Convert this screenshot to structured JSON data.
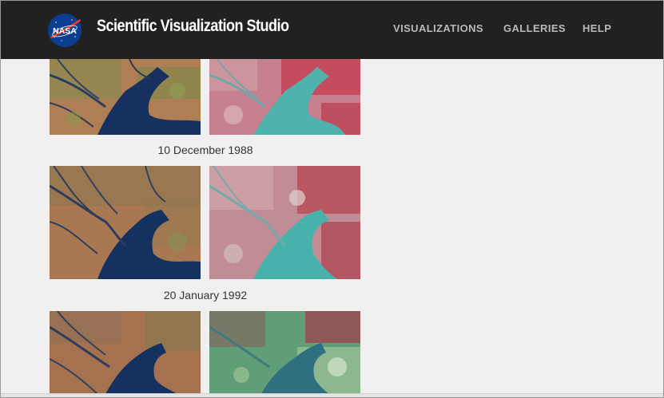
{
  "header": {
    "logo_text": "NASA",
    "site_title": "Scientific Visualization Studio",
    "nav": [
      {
        "label": "VISUALIZATIONS"
      },
      {
        "label": "GALLERIES"
      },
      {
        "label": "HELP"
      }
    ]
  },
  "gallery": {
    "rows": [
      {
        "caption": "10 December 1988",
        "left_image": "natural-color-landsat-delta",
        "right_image": "false-color-landsat-delta"
      },
      {
        "caption": "20 January 1992",
        "left_image": "natural-color-landsat-delta",
        "right_image": "false-color-landsat-delta"
      },
      {
        "caption": "",
        "left_image": "natural-color-landsat-delta",
        "right_image": "false-color-landsat-delta"
      }
    ]
  },
  "colors": {
    "header_bg": "#212121",
    "nav_text": "#b9b9b9",
    "page_bg": "#f0f0f0",
    "caption_text": "#333333",
    "nasa_blue": "#0b3d91",
    "nasa_red": "#fc3d21"
  }
}
